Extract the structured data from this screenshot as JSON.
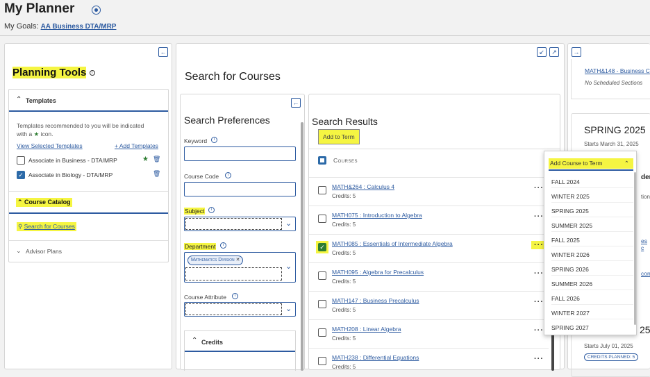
{
  "header": {
    "title": "My Planner",
    "goals_label": "My Goals:",
    "goals_link": "AA Business DTA/MRP"
  },
  "planning": {
    "title": "Planning Tools",
    "templates_label": "Templates",
    "templates_desc_1": "Templates recommended to you will be indicated",
    "templates_desc_2": "with a ",
    "templates_desc_3": " icon.",
    "view_selected": "View Selected Templates",
    "add_templates": "+ Add Templates",
    "template_items": [
      {
        "label": "Associate in Business - DTA/MRP",
        "checked": false,
        "starred": true
      },
      {
        "label": "Associate in Biology - DTA/MRP",
        "checked": true,
        "starred": false
      }
    ],
    "course_catalog": "Course Catalog",
    "search_for_courses": "Search for Courses",
    "advisor_plans": "Advisor Plans"
  },
  "search": {
    "title": "Search for Courses",
    "prefs_title": "Search Preferences",
    "keyword_label": "Keyword",
    "course_code_label": "Course Code",
    "subject_label": "Subject",
    "department_label": "Department",
    "department_tag": "Mathematics Division",
    "course_attribute_label": "Course Attribute",
    "credits_label": "Credits",
    "results_title": "Search Results",
    "add_to_term": "Add to Term",
    "courses_header": "Courses",
    "results": [
      {
        "name": "MATH&264 : Calculus 4",
        "credits": "Credits: 5",
        "checked": false
      },
      {
        "name": "MATH075 : Introduction to Algebra",
        "credits": "Credits: 5",
        "checked": false
      },
      {
        "name": "MATH085 : Essentials of Intermediate Algebra",
        "credits": "Credits: 5",
        "checked": true
      },
      {
        "name": "MATH095 : Algebra for Precalculus",
        "credits": "Credits: 5",
        "checked": false
      },
      {
        "name": "MATH147 : Business Precalculus",
        "credits": "Credits: 5",
        "checked": false
      },
      {
        "name": "MATH208 : Linear Algebra",
        "credits": "Credits: 5",
        "checked": false
      },
      {
        "name": "MATH238 : Differential Equations",
        "credits": "Credits: 5",
        "checked": false
      }
    ]
  },
  "dropdown": {
    "title": "Add Course to Term",
    "terms": [
      "FALL 2024",
      "WINTER 2025",
      "SPRING 2025",
      "SUMMER 2025",
      "FALL 2025",
      "WINTER 2026",
      "SPRING 2026",
      "SUMMER 2026",
      "FALL 2026",
      "WINTER 2027",
      "SPRING 2027"
    ]
  },
  "right": {
    "course_link": "MATH&148 - Business C",
    "no_sections": "No Scheduled Sections",
    "spring_title": "SPRING 2025",
    "spring_starts": "Starts March 31, 2025",
    "partial_1": "ders",
    "partial_2": "tion",
    "partial_3": "es c",
    "partial_4": "con",
    "partial_5": "25",
    "summer_starts": "Starts July 01, 2025",
    "credits_planned": "CREDITS PLANNED: 5"
  },
  "colors": {
    "link": "#2c5aa0",
    "highlight": "#f5f542",
    "checkbox": "#2c6aa8"
  }
}
